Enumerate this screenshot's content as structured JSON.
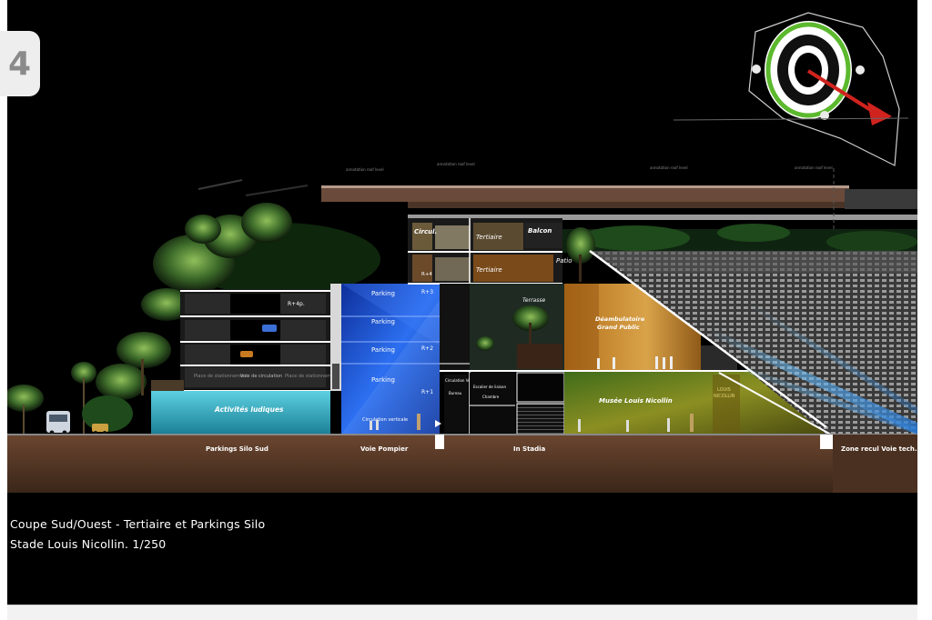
{
  "page_number": "4",
  "caption": {
    "title": "Coupe Sud/Ouest - Tertiaire et Parkings Silo",
    "subtitle": "Stade Louis Nicollin. 1/250"
  },
  "zones": {
    "parkings_silo_sud": "Parkings Silo Sud",
    "voie_pompier": "Voie Pompier",
    "in_stadia": "In Stadia",
    "zone_recul": "Zone recul Voie tech."
  },
  "parking_silo": {
    "level_r4p": "R+4p.",
    "place_stationnement_left": "Place de stationnement",
    "voie_circulation": "Voie de circulation",
    "place_stationnement_right": "Place de stationnement",
    "activites_ludiques": "Activités ludiques"
  },
  "voie_pompier_block": {
    "parking_1": "Parking",
    "parking_2": "Parking",
    "parking_3": "Parking",
    "parking_4": "Parking",
    "level_r3": "R+3",
    "level_r2": "R+2",
    "level_r1": "R+1",
    "vertical_label": "Circulation verticale"
  },
  "tertiary": {
    "circul": "Circul.",
    "tertiaire_top": "Tertiaire",
    "balcon": "Balcon",
    "level_r4": "R+4",
    "tertiaire_mid": "Tertiaire",
    "patio": "Patio",
    "terrasse": "Terrasse",
    "circulation_verticale": "Circulation Verticale",
    "bureau": "Bureau",
    "escalier": "Escalier de liaison",
    "chambre": "Chambre"
  },
  "stadium": {
    "deambulatoire": "Déambulatoire",
    "grand_public": "Grand Public",
    "musee": "Musée Louis Nicollin",
    "side_sign_1": "LOUIS",
    "side_sign_2": "NICOLLIN"
  },
  "colors": {
    "ground": "#5a3a27",
    "activities_glass": "#2fa6b8",
    "parking_blue": "#1c4fd6",
    "deambulatoire": "#c98f2a",
    "musee": "#7f8a1e",
    "roof": "#6a4a3a",
    "locator_red": "#d0231e",
    "locator_green": "#5cb92e"
  },
  "icons": {
    "locator": "stadium-locator-icon",
    "direction": "section-direction-arrow-icon"
  }
}
